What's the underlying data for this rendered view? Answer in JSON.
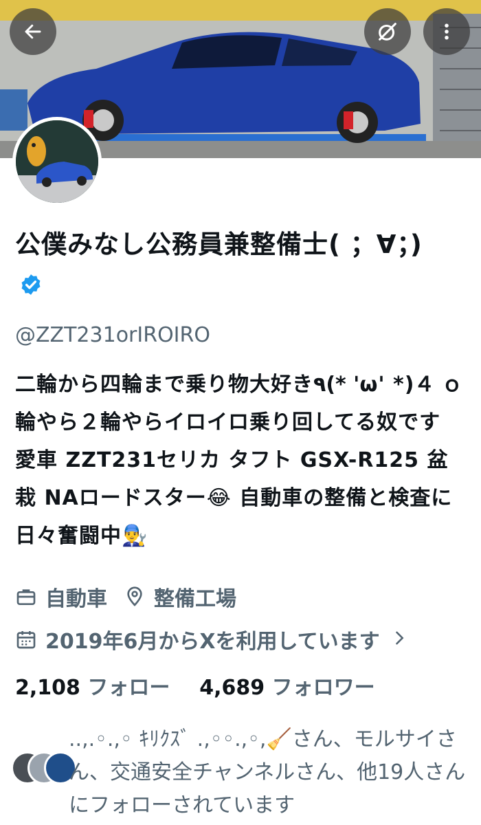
{
  "header": {
    "back_icon": "arrow-left-icon",
    "search_icon": "search-icon",
    "more_icon": "more-vertical-icon"
  },
  "profile": {
    "display_name": "公僕みなし公務員兼整備士( ；∀；)",
    "verified": true,
    "handle": "@ZZT231orIROIRO",
    "bio": "二輪から四輪まで乗り物大好き٩(* 'ω' *)４ ｏ輪やら２輪やらイロイロ乗り回してる奴です 愛車 ZZT231セリカ タフト GSX-R125 盆栽 NAロードスター😂 自動車の整備と検査に日々奮闘中👨‍🔧",
    "category": "自動車",
    "location": "整備工場",
    "joined": "2019年6月からXを利用しています",
    "following_count": "2,108",
    "following_label": "フォロー",
    "followers_count": "4,689",
    "followers_label": "フォロワー",
    "followed_by": "..,.◦.,◦ ｷﾘｸｽﾞ .,◦◦.,◦,🧹さん、モルサイさん、交通安全チャンネルさん、他19人さんにフォローされています"
  },
  "colors": {
    "accent": "#1d9bf0",
    "secondary_text": "#536471",
    "primary_text": "#0f1419"
  }
}
